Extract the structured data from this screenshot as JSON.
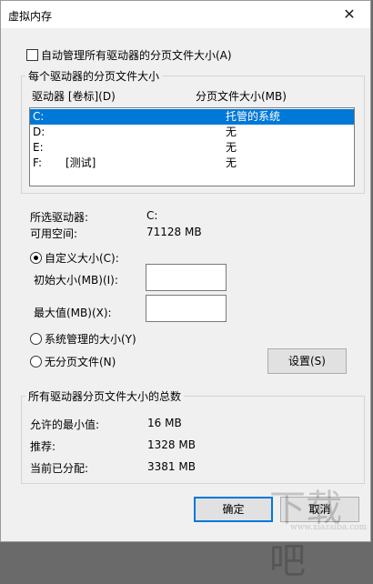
{
  "window": {
    "title": "虚拟内存",
    "close_glyph": "✕"
  },
  "auto_manage": {
    "label": "自动管理所有驱动器的分页文件大小(A)",
    "checked": false
  },
  "drives_group": {
    "title": "每个驱动器的分页文件大小",
    "col_drive": "驱动器 [卷标](D)",
    "col_paging": "分页文件大小(MB)",
    "rows": [
      {
        "drive": "C:",
        "label": "",
        "size": "托管的系统",
        "selected": true
      },
      {
        "drive": "D:",
        "label": "",
        "size": "无",
        "selected": false
      },
      {
        "drive": "E:",
        "label": "",
        "size": "无",
        "selected": false
      },
      {
        "drive": "F:",
        "label": "[测试]",
        "size": "无",
        "selected": false
      }
    ]
  },
  "selected_drive": {
    "label": "所选驱动器:",
    "value": "C:"
  },
  "free_space": {
    "label": "可用空间:",
    "value": "71128 MB"
  },
  "options": {
    "custom": {
      "label": "自定义大小(C):",
      "selected": true
    },
    "initial": {
      "label": "初始大小(MB)(I):",
      "value": ""
    },
    "max": {
      "label": "最大值(MB)(X):",
      "value": ""
    },
    "system": {
      "label": "系统管理的大小(Y)",
      "selected": false
    },
    "none": {
      "label": "无分页文件(N)",
      "selected": false
    },
    "set_button": "设置(S)"
  },
  "totals_group": {
    "title": "所有驱动器分页文件大小的总数",
    "min_allowed": {
      "label": "允许的最小值:",
      "value": "16 MB"
    },
    "recommended": {
      "label": "推荐:",
      "value": "1328 MB"
    },
    "allocated": {
      "label": "当前已分配:",
      "value": "3381 MB"
    }
  },
  "buttons": {
    "ok": "确定",
    "cancel": "取消"
  },
  "watermark": {
    "text": "下载吧",
    "sub": "www.xiazaiba.com"
  }
}
